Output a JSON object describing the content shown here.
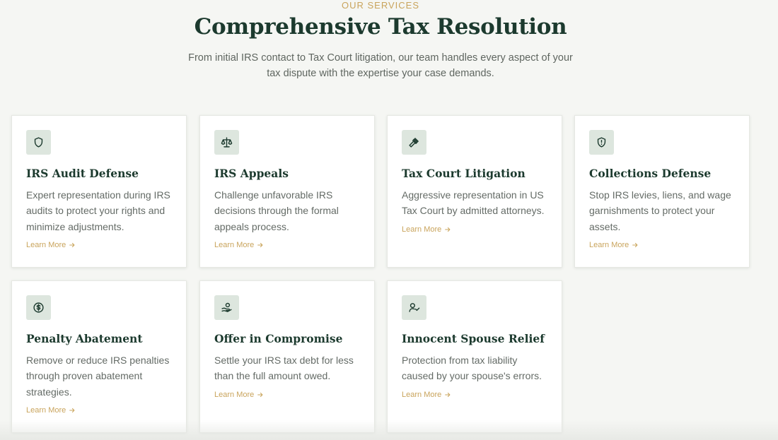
{
  "header": {
    "eyebrow": "OUR SERVICES",
    "title": "Comprehensive Tax Resolution",
    "subtitle": "From initial IRS contact to Tax Court litigation, our team handles every aspect of your tax dispute with the expertise your case demands."
  },
  "colors": {
    "primary": "#1c3a2e",
    "accent": "#c9a45c",
    "icon_bg": "#dde6de",
    "background": "#f5f6f3"
  },
  "services": [
    {
      "icon": "shield-icon",
      "title": "IRS Audit Defense",
      "desc": "Expert representation during IRS audits to protect your rights and minimize adjustments.",
      "link": "Learn More"
    },
    {
      "icon": "scale-icon",
      "title": "IRS Appeals",
      "desc": "Challenge unfavorable IRS decisions through the formal appeals process.",
      "link": "Learn More"
    },
    {
      "icon": "gavel-icon",
      "title": "Tax Court Litigation",
      "desc": "Aggressive representation in US Tax Court by admitted attorneys.",
      "link": "Learn More"
    },
    {
      "icon": "shield-alert-icon",
      "title": "Collections Defense",
      "desc": "Stop IRS levies, liens, and wage garnishments to protect your assets.",
      "link": "Learn More"
    },
    {
      "icon": "dollar-circle-icon",
      "title": "Penalty Abatement",
      "desc": "Remove or reduce IRS penalties through proven abatement strategies.",
      "link": "Learn More"
    },
    {
      "icon": "hand-coins-icon",
      "title": "Offer in Compromise",
      "desc": "Settle your IRS tax debt for less than the full amount owed.",
      "link": "Learn More"
    },
    {
      "icon": "user-check-icon",
      "title": "Innocent Spouse Relief",
      "desc": "Protection from tax liability caused by your spouse's errors.",
      "link": "Learn More"
    }
  ]
}
